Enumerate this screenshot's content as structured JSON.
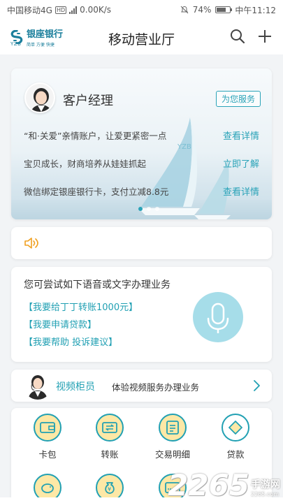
{
  "status": {
    "carrier": "中国移动4G",
    "hd": "HD",
    "speed": "0.00K/s",
    "battery": "74%",
    "battery_level": 0.74,
    "time": "中午11:12"
  },
  "header": {
    "logo_name": "银座银行",
    "logo_slogan": "简单 方便 快捷",
    "logo_abbr": "YZB",
    "title": "移动营业厅",
    "search_icon": "search-icon",
    "add_icon": "plus-icon"
  },
  "banner": {
    "title": "客户经理",
    "serve_button": "为您服务",
    "rows": [
      {
        "text": "“和·关爱”亲情账户，让爱更紧密一点",
        "link": "查看详情"
      },
      {
        "text": "宝贝成长，财商培养从娃娃抓起",
        "link": "立即了解"
      },
      {
        "text": "微信绑定银座银行卡，支付立减8.8元",
        "link": "查看详情"
      }
    ],
    "slide_count": 3,
    "active_slide": 0
  },
  "notice": {
    "icon": "speaker-icon"
  },
  "voice": {
    "hint": "您可尝试如下语音或文字办理业务",
    "commands": [
      "【我要给丁丁转账1000元】",
      "【我要申请贷款】",
      "【我要帮助 投诉建议】"
    ],
    "mic_icon": "microphone-icon"
  },
  "video": {
    "label": "视频柜员",
    "desc": "体验视频服务办理业务"
  },
  "grid": {
    "items": [
      {
        "label": "卡包",
        "icon": "wallet-icon"
      },
      {
        "label": "转账",
        "icon": "transfer-icon"
      },
      {
        "label": "交易明细",
        "icon": "list-icon"
      },
      {
        "label": "贷款",
        "icon": "loan-icon"
      }
    ]
  },
  "watermark": {
    "number": "2265",
    "name": "手游网",
    "url": "2265.com"
  },
  "colors": {
    "accent": "#21a0b3",
    "brand": "#1b7f9c"
  }
}
